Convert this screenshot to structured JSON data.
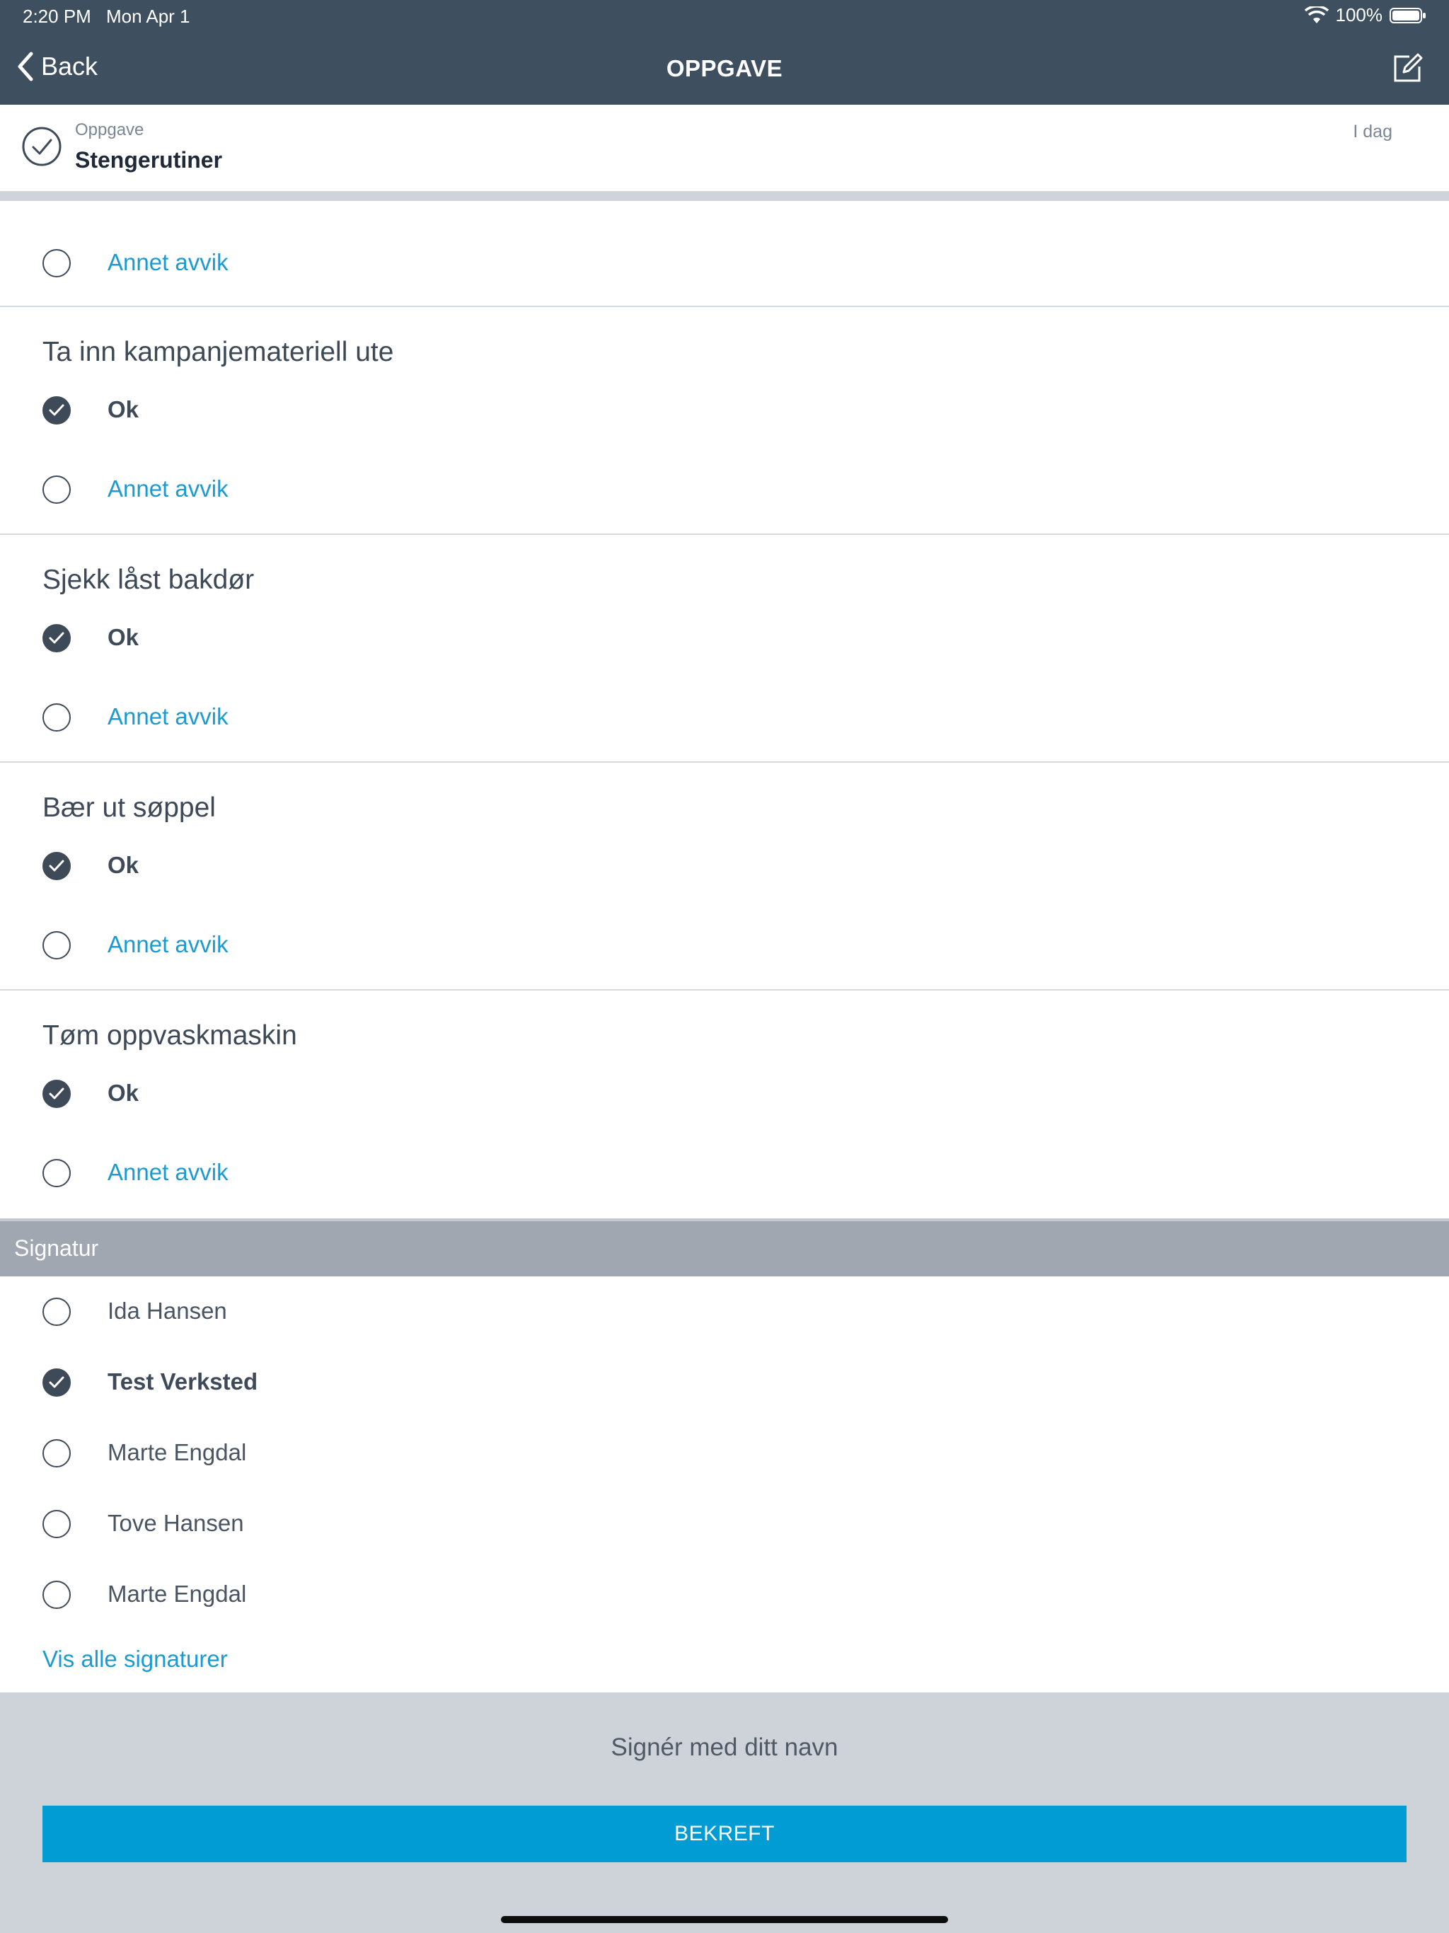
{
  "status_bar": {
    "time": "2:20 PM",
    "date": "Mon Apr 1",
    "battery": "100%"
  },
  "nav": {
    "back_label": "Back",
    "title": "OPPGAVE",
    "edit_icon": "compose-icon"
  },
  "task": {
    "kind": "Oppgave",
    "title": "Stengerutiner",
    "date": "I dag"
  },
  "checklist": [
    {
      "title": "",
      "options": [
        {
          "label": "Annet avvik",
          "checked": false
        }
      ]
    },
    {
      "title": "Ta inn kampanjemateriell ute",
      "options": [
        {
          "label": "Ok",
          "checked": true
        },
        {
          "label": "Annet avvik",
          "checked": false
        }
      ]
    },
    {
      "title": "Sjekk låst bakdør",
      "options": [
        {
          "label": "Ok",
          "checked": true
        },
        {
          "label": "Annet avvik",
          "checked": false
        }
      ]
    },
    {
      "title": "Bær ut søppel",
      "options": [
        {
          "label": "Ok",
          "checked": true
        },
        {
          "label": "Annet avvik",
          "checked": false
        }
      ]
    },
    {
      "title": "Tøm oppvaskmaskin",
      "options": [
        {
          "label": "Ok",
          "checked": true
        },
        {
          "label": "Annet avvik",
          "checked": false
        }
      ]
    }
  ],
  "signature": {
    "header": "Signatur",
    "people": [
      {
        "name": "Ida Hansen",
        "checked": false
      },
      {
        "name": "Test Verksted",
        "checked": true
      },
      {
        "name": "Marte Engdal",
        "checked": false
      },
      {
        "name": "Tove Hansen",
        "checked": false
      },
      {
        "name": "Marte Engdal",
        "checked": false
      }
    ],
    "show_all": "Vis alle signaturer",
    "sign_prompt": "Signér med ditt navn",
    "confirm_label": "BEKREFT"
  },
  "colors": {
    "nav_bg": "#3e4f5f",
    "accent": "#029cd4",
    "link": "#1b9bd2",
    "check": "#3e4a58"
  }
}
